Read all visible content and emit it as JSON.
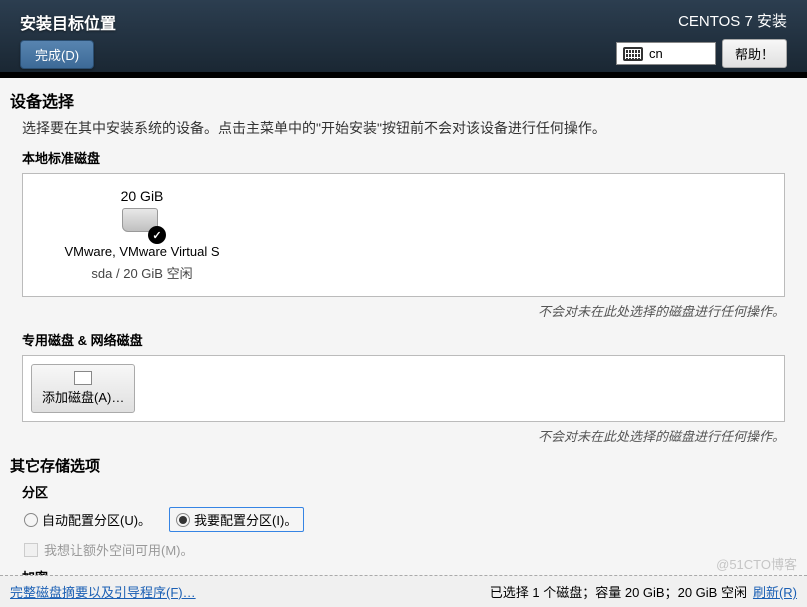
{
  "header": {
    "title": "安装目标位置",
    "done_label": "完成(D)",
    "install_title": "CENTOS 7 安装",
    "lang": "cn",
    "help_label": "帮助！"
  },
  "device_selection": {
    "title": "设备选择",
    "description": "选择要在其中安装系统的设备。点击主菜单中的\"开始安装\"按钮前不会对该设备进行任何操作。"
  },
  "local_disks": {
    "label": "本地标准磁盘",
    "disk": {
      "size": "20 GiB",
      "name": "VMware, VMware Virtual S",
      "info": "sda    /    20 GiB 空闲"
    },
    "hint": "不会对未在此处选择的磁盘进行任何操作。"
  },
  "special_disks": {
    "label": "专用磁盘 & 网络磁盘",
    "add_label": "添加磁盘(A)…",
    "hint": "不会对未在此处选择的磁盘进行任何操作。"
  },
  "other_storage": {
    "title": "其它存储选项",
    "partition_label": "分区",
    "auto_label": "自动配置分区(U)。",
    "manual_label": "我要配置分区(I)。",
    "extra_space_label": "我想让额外空间可用(M)。",
    "encrypt_label": "加密"
  },
  "footer": {
    "summary_link": "完整磁盘摘要以及引导程序(F)…",
    "selected_text": "已选择 1 个磁盘；容量 20 GiB；20 GiB 空闲",
    "refresh_link": "刷新(R)"
  },
  "watermark": "@51CTO博客"
}
